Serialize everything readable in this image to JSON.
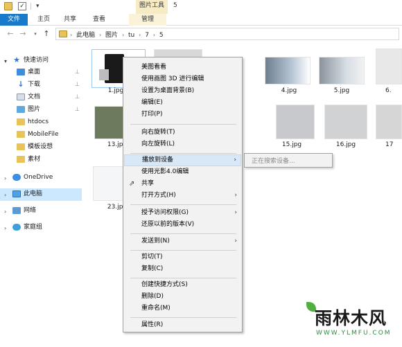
{
  "window": {
    "title": "5",
    "picture_tools": "图片工具"
  },
  "ribbon": {
    "tabs": [
      "文件",
      "主页",
      "共享",
      "查看",
      "管理"
    ]
  },
  "address": {
    "crumbs": [
      "此电脑",
      "图片",
      "tu",
      "7",
      "5"
    ]
  },
  "nav": {
    "items": [
      "快速访问",
      "桌面",
      "下载",
      "文档",
      "图片",
      "htdocs",
      "MobileFile",
      "模板设想",
      "素材",
      "OneDrive",
      "此电脑",
      "网络",
      "家庭组"
    ]
  },
  "files": [
    {
      "name": "1.jpg"
    },
    {
      "name": "4.jpg"
    },
    {
      "name": "5.jpg"
    },
    {
      "name": "6."
    },
    {
      "name": "13.jpg"
    },
    {
      "name": "15.jpg"
    },
    {
      "name": "16.jpg"
    },
    {
      "name": "17"
    },
    {
      "name": "23.jpg"
    }
  ],
  "context_menu": {
    "items": [
      "美图看看",
      "使用画图 3D 进行编辑",
      "设置为桌面背景(B)",
      "编辑(E)",
      "打印(P)",
      "向右旋转(T)",
      "向左旋转(L)",
      "播放到设备",
      "使用光影4.0编辑",
      "共享",
      "打开方式(H)",
      "授予访问权限(G)",
      "还原以前的版本(V)",
      "发送到(N)",
      "剪切(T)",
      "复制(C)",
      "创建快捷方式(S)",
      "删除(D)",
      "重命名(M)",
      "属性(R)"
    ],
    "submenu_status": "正在搜索设备..."
  },
  "watermark": {
    "text": "雨林木风",
    "url": "WWW.YLMFU.COM"
  },
  "colors": {
    "file_tab": "#1979ca",
    "selection": "#cce8ff",
    "highlight": "#d9e8f7",
    "manage_tab": "#fbf3d9"
  }
}
